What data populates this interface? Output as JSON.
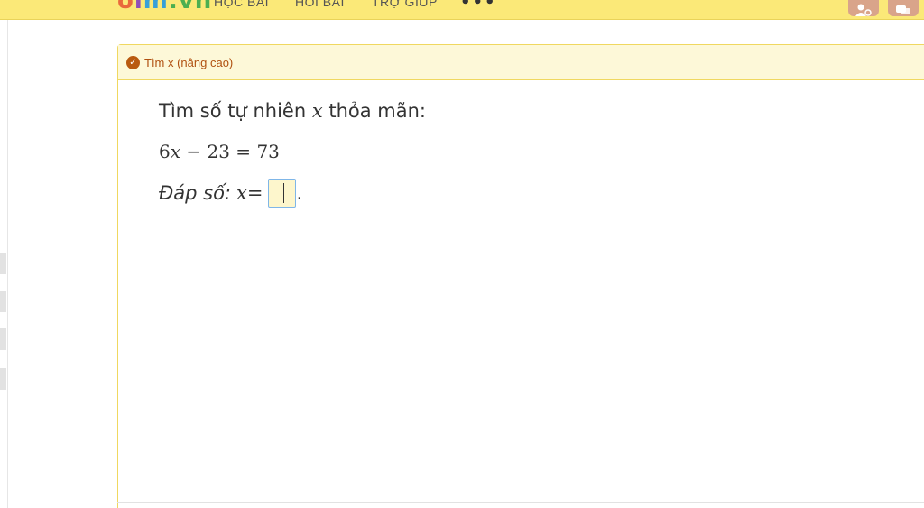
{
  "header": {
    "logo": [
      "o",
      "l",
      "m",
      ".vn"
    ],
    "nav": [
      {
        "label": "HỌC BÀI"
      },
      {
        "label": "HỎI BÀI"
      },
      {
        "label": "TRỢ GIÚP"
      }
    ],
    "more_label": "•••"
  },
  "card": {
    "title": "Tìm x (nâng cao)",
    "prompt_before": "Tìm số tự nhiên ",
    "prompt_var": "x",
    "prompt_after": " thỏa mãn:",
    "equation": {
      "coef": "6",
      "var": "x",
      "op1": " − ",
      "num1": "23",
      "op2": " = ",
      "num2": "73"
    },
    "answer": {
      "label": "Đáp số:",
      "var": "x",
      "eq": " = ",
      "value": "",
      "end": "."
    }
  },
  "colors": {
    "header_bg": "#fbe978",
    "card_header_bg": "#fdf8d8",
    "card_border": "#f0d860",
    "title_color": "#b05010",
    "input_border": "#7fb6e8",
    "input_bg": "#fdf6cc"
  }
}
